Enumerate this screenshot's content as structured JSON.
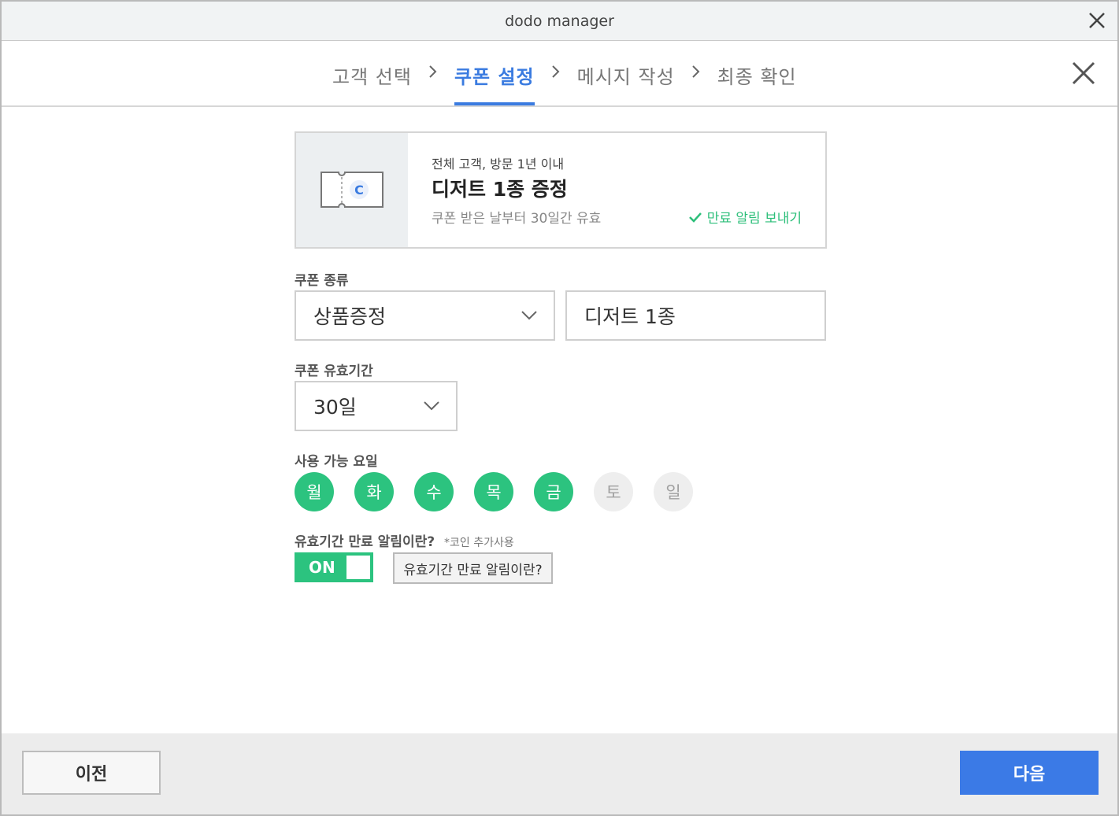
{
  "window": {
    "title": "dodo manager"
  },
  "steps": [
    {
      "label": "고객 선택",
      "active": false
    },
    {
      "label": "쿠폰 설정",
      "active": true
    },
    {
      "label": "메시지 작성",
      "active": false
    },
    {
      "label": "최종 확인",
      "active": false
    }
  ],
  "coupon_card": {
    "target": "전체 고객, 방문 1년 이내",
    "title": "디저트 1종 증정",
    "validity": "쿠폰 받은 날부터 30일간 유효",
    "notify": "만료 알림 보내기",
    "icon_letter": "C"
  },
  "coupon_type": {
    "label": "쿠폰 종류",
    "selected": "상품증정",
    "item_value": "디저트 1종"
  },
  "validity_period": {
    "label": "쿠폰 유효기간",
    "selected": "30일"
  },
  "available_days": {
    "label": "사용 가능 요일",
    "days": [
      {
        "label": "월",
        "enabled": true
      },
      {
        "label": "화",
        "enabled": true
      },
      {
        "label": "수",
        "enabled": true
      },
      {
        "label": "목",
        "enabled": true
      },
      {
        "label": "금",
        "enabled": true
      },
      {
        "label": "토",
        "enabled": false
      },
      {
        "label": "일",
        "enabled": false
      }
    ]
  },
  "expiry_notice": {
    "label": "유효기간 만료 알림이란?",
    "note": "*코인 추가사용",
    "toggle_state": "ON",
    "info_button": "유효기간 만료 알림이란?"
  },
  "footer": {
    "prev": "이전",
    "next": "다음"
  },
  "colors": {
    "accent": "#3a7be0",
    "green": "#2cc37f"
  }
}
